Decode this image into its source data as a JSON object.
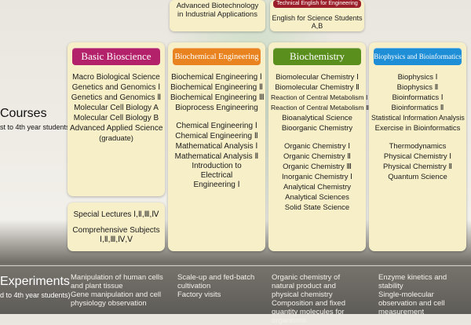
{
  "top_cards": [
    {
      "lines": [
        "Advanced Biotechnology",
        "in Industrial Applications"
      ]
    },
    {
      "header": "Technical English for Engineering",
      "lines": [
        "English for Science Students A,B"
      ]
    }
  ],
  "courses_label": {
    "title": "Courses",
    "sub": "st to 4th year students)"
  },
  "experiments_label": {
    "title": "Experiments",
    "sub": "d to 4th year students)"
  },
  "colors": {
    "basic": "#b4216b",
    "engineering": "#e8831f",
    "biochemistry": "#5a8f1e",
    "biophysics": "#1e8ed6",
    "card_bg": "#f6efc8"
  },
  "columns": [
    {
      "header": "Basic Bioscience",
      "items": [
        "Macro Biological Science",
        "Genetics and Genomics Ⅰ",
        "Genetics and Genomics Ⅱ",
        "Molecular Cell Biology A",
        "Molecular Cell Biology B",
        "Advanced Applied Science",
        "(graduate)"
      ]
    },
    {
      "header": "Biochemical Engineering",
      "items": [
        "Biochemical Engineering Ⅰ",
        "Biochemical Engineering Ⅱ",
        "Biochemical Engineering Ⅲ",
        "Bioprocess Engineering",
        "",
        "Chemical Engineering Ⅰ",
        "Chemical Engineering Ⅱ",
        "Mathematical Analysis Ⅰ",
        "Mathematical Analysis Ⅱ",
        "Introduction to Electrical Engineering Ⅰ"
      ]
    },
    {
      "header": "Biochemistry",
      "items": [
        "Biomolecular Chemistry Ⅰ",
        "Biomolecular Chemistry Ⅱ",
        "Reaction of Central Metabolism Ⅰ",
        "Reaction of Central Metabolism Ⅱ",
        "Bioanalytical Science",
        "Bioorganic Chemistry",
        "",
        "Organic Chemistry Ⅰ",
        "Organic Chemistry Ⅱ",
        "Organic Chemistry Ⅲ",
        "Inorganic Chemistry Ⅰ",
        "Analytical Chemistry",
        "Analytical Sciences",
        "Solid State Science"
      ]
    },
    {
      "header": "Biophysics and Bioinformatics",
      "items": [
        "Biophysics Ⅰ",
        "Biophysics Ⅱ",
        "Bioinformatics Ⅰ",
        "Bioinformatics Ⅱ",
        "Statistical Information Analysis",
        "Exercise in Bioinformatics",
        "",
        "Thermodynamics",
        "Physical Chemistry Ⅰ",
        "Physical Chemistry Ⅱ",
        "Quantum Science"
      ]
    }
  ],
  "lectures": {
    "special": "Special Lectures Ⅰ,Ⅱ,Ⅲ,Ⅳ",
    "comprehensive_1": "Comprehensive Subjects",
    "comprehensive_2": "Ⅰ,Ⅱ,Ⅲ,Ⅳ,Ⅴ"
  },
  "experiments": [
    "Manipulation of human cells and plant tissue\nGene manipulation and cell physiology observation",
    "Scale-up and fed-batch cultivation\nFactory visits",
    "Organic chemistry of natural product and physical chemistry\nComposition and fixed quantity molecules for organisms",
    "Enzyme kinetics and stability\nSingle-molecular observation and cell measurement"
  ]
}
